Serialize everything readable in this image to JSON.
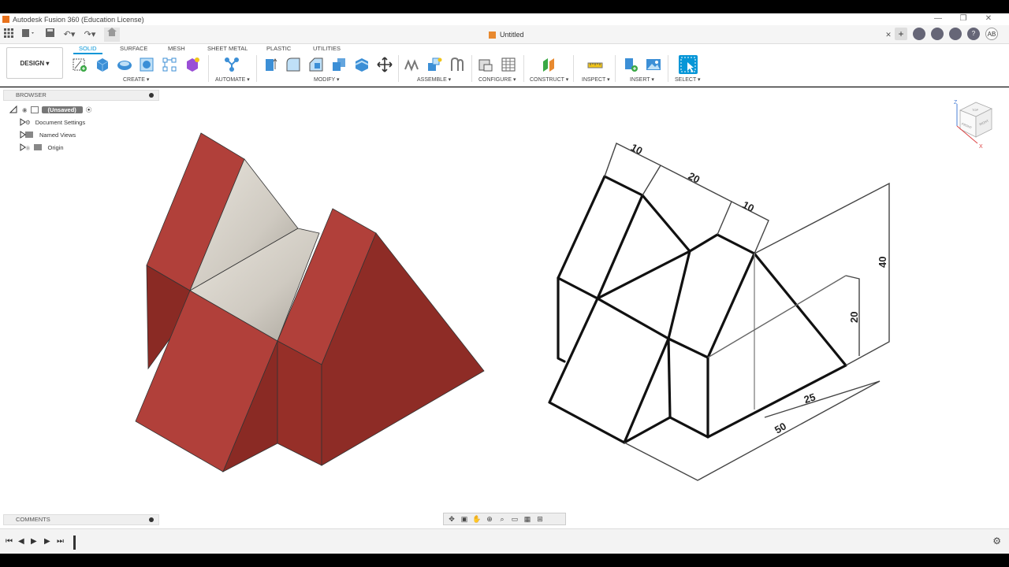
{
  "window": {
    "title": "Autodesk Fusion 360 (Education License)",
    "minimize": "—",
    "restore": "❐",
    "close": "✕"
  },
  "document": {
    "tab_title": "Untitled",
    "close_tab": "✕"
  },
  "user": {
    "initials": "AB"
  },
  "workspace": {
    "label": "DESIGN ▾"
  },
  "ribbon": {
    "tabs": [
      "SOLID",
      "SURFACE",
      "MESH",
      "SHEET METAL",
      "PLASTIC",
      "UTILITIES"
    ],
    "active_tab": "SOLID",
    "groups": [
      "CREATE ▾",
      "AUTOMATE ▾",
      "MODIFY ▾",
      "ASSEMBLE ▾",
      "CONFIGURE ▾",
      "CONSTRUCT ▾",
      "INSPECT ▾",
      "INSERT ▾",
      "SELECT ▾"
    ]
  },
  "browser": {
    "title": "BROWSER",
    "root": "(Unsaved)",
    "items": [
      "Document Settings",
      "Named Views",
      "Origin"
    ]
  },
  "comments": {
    "title": "COMMENTS"
  },
  "viewcube": {
    "top": "TOP",
    "front": "FRONT",
    "right": "RIGHT",
    "z": "Z",
    "x": "X"
  },
  "drawing": {
    "dim_10_top": "10",
    "dim_20_top": "20",
    "dim_10_mid": "10",
    "dim_40": "40",
    "dim_20_right": "20",
    "dim_25": "25",
    "dim_50": "50"
  },
  "colors": {
    "accent": "#0696d7",
    "solid_red": "#a8382f",
    "solid_red_dark": "#8a2a24",
    "groove_gray": "#d8d4cc"
  }
}
